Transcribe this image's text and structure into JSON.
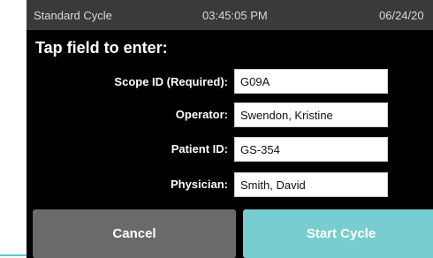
{
  "status_bar": {
    "cycle_name": "Standard Cycle",
    "time": "03:45:05 PM",
    "date": "06/24/20"
  },
  "instruction": "Tap field to enter:",
  "fields": [
    {
      "label": "Scope ID (Required):",
      "value": "G09A"
    },
    {
      "label": "Operator:",
      "value": "Swendon, Kristine"
    },
    {
      "label": "Patient ID:",
      "value": "GS-354"
    },
    {
      "label": "Physician:",
      "value": "Smith, David"
    }
  ],
  "buttons": {
    "cancel_label": "Cancel",
    "start_label": "Start Cycle"
  },
  "colors": {
    "status_bar_bg": "#3a3a3a",
    "screen_bg": "#000000",
    "cancel_bg": "#6a6a6a",
    "start_bg": "#78cdd0",
    "accent": "#5ec7c9"
  }
}
